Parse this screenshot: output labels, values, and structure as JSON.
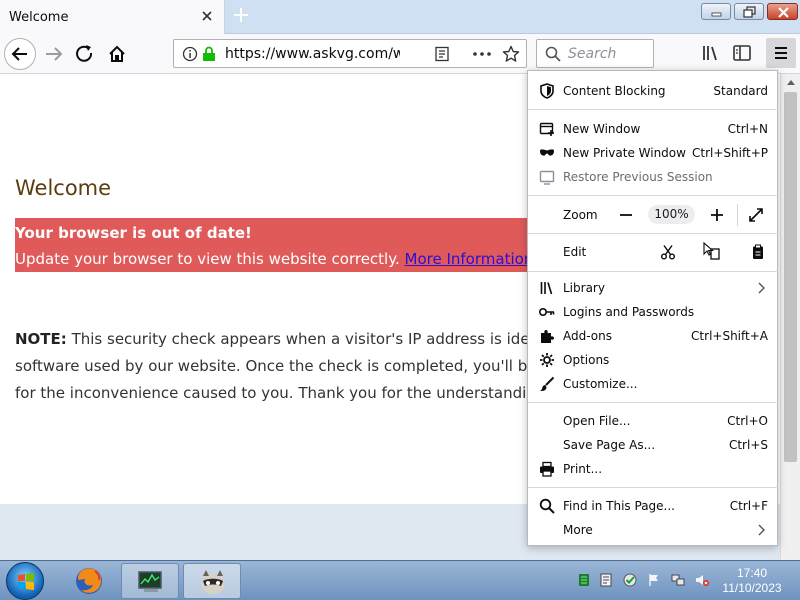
{
  "tab": {
    "title": "Welcome"
  },
  "urlbar": {
    "url": "https://www.askvg.com/wha"
  },
  "searchbar": {
    "placeholder": "Search"
  },
  "page": {
    "heading": "Welcome",
    "banner_title": "Your browser is out of date!",
    "banner_msg": "Update your browser to view this website correctly.",
    "banner_link": "More Information.",
    "note_label": "NOTE:",
    "note_line1": "This security check appears when a visitor's IP address is identified",
    "note_line2": "software used by our website. Once the check is completed, you'll be able t",
    "note_line3": "for the inconvenience caused to you. Thank you for the understanding."
  },
  "menu": {
    "content_blocking": {
      "label": "Content Blocking",
      "value": "Standard"
    },
    "new_window": {
      "label": "New Window",
      "shortcut": "Ctrl+N"
    },
    "new_private": {
      "label": "New Private Window",
      "shortcut": "Ctrl+Shift+P"
    },
    "restore": {
      "label": "Restore Previous Session"
    },
    "zoom": {
      "label": "Zoom",
      "value": "100%"
    },
    "edit": {
      "label": "Edit"
    },
    "library": {
      "label": "Library"
    },
    "logins": {
      "label": "Logins and Passwords"
    },
    "addons": {
      "label": "Add-ons",
      "shortcut": "Ctrl+Shift+A"
    },
    "options": {
      "label": "Options"
    },
    "customize": {
      "label": "Customize..."
    },
    "open_file": {
      "label": "Open File...",
      "shortcut": "Ctrl+O"
    },
    "save_page": {
      "label": "Save Page As...",
      "shortcut": "Ctrl+S"
    },
    "print": {
      "label": "Print..."
    },
    "find": {
      "label": "Find in This Page...",
      "shortcut": "Ctrl+F"
    },
    "more": {
      "label": "More"
    }
  },
  "taskbar": {
    "time": "17:40",
    "date": "11/10/2023"
  },
  "colors": {
    "banner": "#e05a5a",
    "heading": "#5c3d10",
    "link": "#2a0fd4"
  }
}
